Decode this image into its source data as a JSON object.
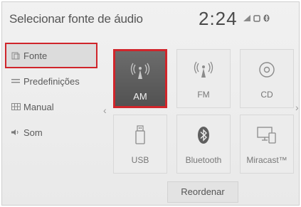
{
  "header": {
    "title": "Selecionar fonte de áudio",
    "clock": "2:24"
  },
  "status_icons": [
    "signal-icon",
    "phone-icon",
    "bluetooth-icon"
  ],
  "sidebar": {
    "items": [
      {
        "label": "Fonte",
        "icon": "source-icon",
        "selected": true
      },
      {
        "label": "Predefinições",
        "icon": "presets-icon",
        "selected": false
      },
      {
        "label": "Manual",
        "icon": "manual-icon",
        "selected": false
      },
      {
        "label": "Som",
        "icon": "speaker-icon",
        "selected": false
      }
    ]
  },
  "sources": [
    {
      "label": "AM",
      "icon": "am-antenna-icon",
      "active": true
    },
    {
      "label": "FM",
      "icon": "fm-antenna-icon",
      "active": false
    },
    {
      "label": "CD",
      "icon": "cd-icon",
      "active": false
    },
    {
      "label": "USB",
      "icon": "usb-icon",
      "active": false
    },
    {
      "label": "Bluetooth",
      "icon": "bluetooth-icon",
      "active": false
    },
    {
      "label": "Miracast™",
      "icon": "miracast-icon",
      "active": false
    }
  ],
  "actions": {
    "reorder_label": "Reordenar"
  },
  "colors": {
    "highlight": "#d0252b",
    "active_tile": "#5e5e5e",
    "background": "#ececec"
  }
}
